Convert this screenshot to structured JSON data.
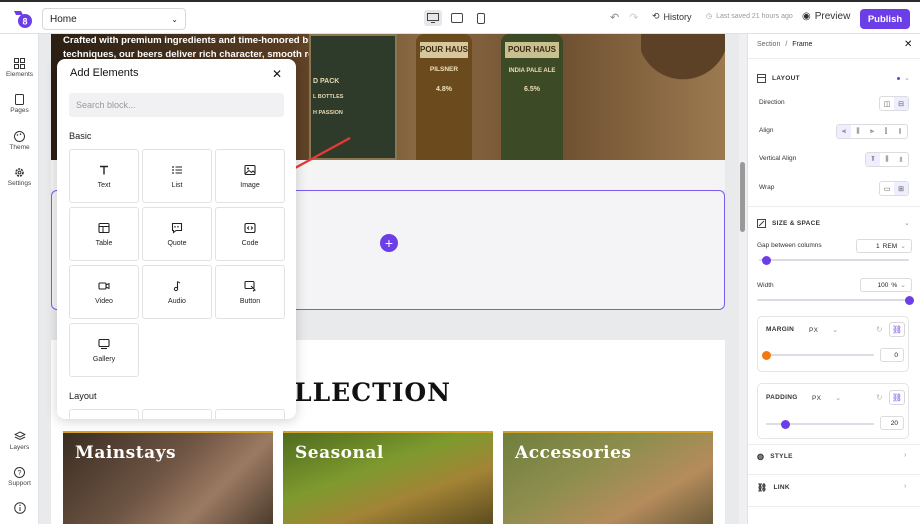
{
  "topbar": {
    "page_selector": "Home",
    "history_label": "History",
    "saved_label": "Last saved 21 hours ago",
    "preview_label": "Preview",
    "publish_label": "Publish"
  },
  "rail": {
    "items": [
      {
        "label": "Elements",
        "icon": "grid-icon"
      },
      {
        "label": "Pages",
        "icon": "pages-icon"
      },
      {
        "label": "Theme",
        "icon": "palette-icon"
      },
      {
        "label": "Settings",
        "icon": "gear-icon"
      }
    ],
    "bottom": [
      {
        "label": "Layers",
        "icon": "layers-icon"
      },
      {
        "label": "Support",
        "icon": "help-icon"
      }
    ]
  },
  "canvas": {
    "hero_text": "Crafted with premium ingredients and time-honored brewing techniques, our beers deliver rich character, smooth refreshment, and unforgettable flavor in",
    "bottle_labels": [
      "POUR HAUS",
      "PILSNER",
      "4.8%",
      "POUR HAUS",
      "INDIA PALE ALE",
      "6.5%",
      "D PACK",
      "L BOTTLES",
      "H PASSION"
    ],
    "collection_title": "LLECTION",
    "cards": [
      "Mainstays",
      "Seasonal",
      "Accessories"
    ]
  },
  "add_elements": {
    "title": "Add Elements",
    "search_placeholder": "Search block...",
    "basic_label": "Basic",
    "layout_label": "Layout",
    "tiles": [
      "Text",
      "List",
      "Image",
      "Table",
      "Quote",
      "Code",
      "Video",
      "Audio",
      "Button",
      "Gallery"
    ]
  },
  "right_panel": {
    "breadcrumb_parent": "Section",
    "breadcrumb_sep": "/",
    "breadcrumb_current": "Frame",
    "layout_heading": "LAYOUT",
    "direction_label": "Direction",
    "align_label": "Align",
    "valign_label": "Vertical Align",
    "wrap_label": "Wrap",
    "size_heading": "SIZE & SPACE",
    "gap_label": "Gap between columns",
    "gap_value": "1",
    "gap_unit": "REM",
    "gap_level": 0.05,
    "width_label": "Width",
    "width_value": "100",
    "width_unit": "%",
    "width_level": 1.0,
    "margin_label": "MARGIN",
    "margin_unit": "PX",
    "margin_value": "0",
    "margin_level": 0.0,
    "padding_label": "PADDING",
    "padding_unit": "PX",
    "padding_value": "20",
    "padding_level": 0.18,
    "style_heading": "STYLE",
    "link_heading": "LINK",
    "accent_color": "#6b3ee8"
  }
}
